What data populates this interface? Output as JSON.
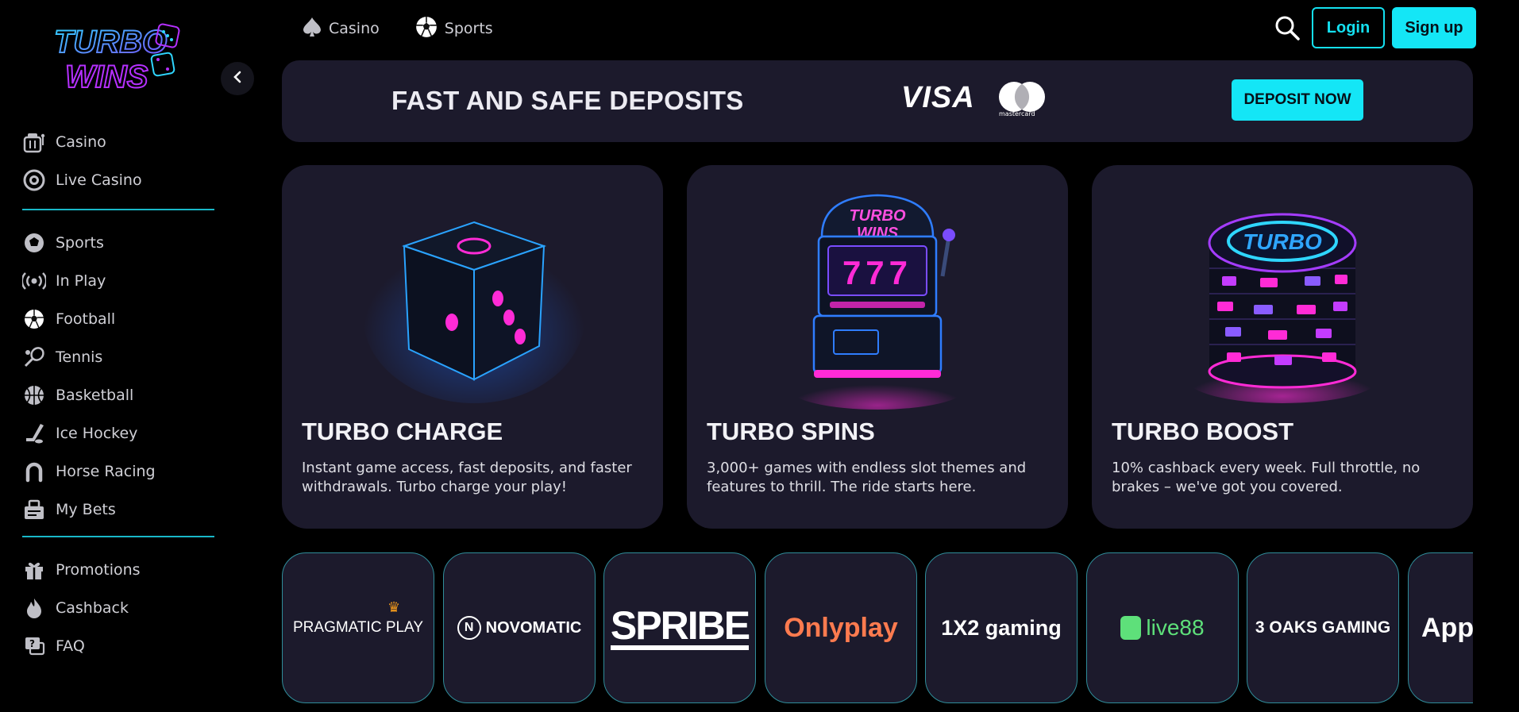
{
  "brand": {
    "logo_line1": "TURBO",
    "logo_line2": "WINS"
  },
  "sidebar": {
    "group1": [
      {
        "label": "Casino",
        "icon": "slot-machine-icon"
      },
      {
        "label": "Live Casino",
        "icon": "casino-chip-icon"
      }
    ],
    "group2": [
      {
        "label": "Sports",
        "icon": "sports-ball-icon"
      },
      {
        "label": "In Play",
        "icon": "broadcast-icon"
      },
      {
        "label": "Football",
        "icon": "football-icon"
      },
      {
        "label": "Tennis",
        "icon": "tennis-racket-icon"
      },
      {
        "label": "Basketball",
        "icon": "basketball-icon"
      },
      {
        "label": "Ice Hockey",
        "icon": "hockey-stick-icon"
      },
      {
        "label": "Horse Racing",
        "icon": "horseshoe-icon"
      },
      {
        "label": "My Bets",
        "icon": "bet-slip-icon"
      }
    ],
    "group3": [
      {
        "label": "Promotions",
        "icon": "gift-icon"
      },
      {
        "label": "Cashback",
        "icon": "flame-icon"
      },
      {
        "label": "FAQ",
        "icon": "question-chat-icon"
      }
    ]
  },
  "topnav": {
    "casino": "Casino",
    "sports": "Sports"
  },
  "auth": {
    "login": "Login",
    "signup": "Sign up"
  },
  "deposit": {
    "title": "FAST AND SAFE DEPOSITS",
    "visa": "VISA",
    "mastercard": "mastercard",
    "button": "DEPOSIT NOW"
  },
  "features": [
    {
      "title": "TURBO CHARGE",
      "desc": "Instant game access, fast deposits, and faster withdrawals. Turbo charge your play!"
    },
    {
      "title": "TURBO SPINS",
      "desc": "3,000+ games with endless slot themes and features to thrill. The ride starts here.",
      "art_text_top": "TURBO",
      "art_text_bottom": "WINS",
      "art_reels": "777"
    },
    {
      "title": "TURBO BOOST",
      "desc": "10% cashback every week. Full throttle, no brakes – we've got you covered.",
      "art_text": "TURBO"
    }
  ],
  "providers": [
    "PRAGMATIC PLAY",
    "NOVOMATIC",
    "SPRIBE",
    "Onlyplay",
    "1X2 gaming",
    "live88",
    "3 OAKS GAMING",
    "App"
  ],
  "colors": {
    "accent": "#14e6f6",
    "card_bg": "#1c1a2c",
    "divider": "#19b8c8",
    "neon_pink": "#ff2bd6",
    "neon_blue": "#2f7dff"
  }
}
